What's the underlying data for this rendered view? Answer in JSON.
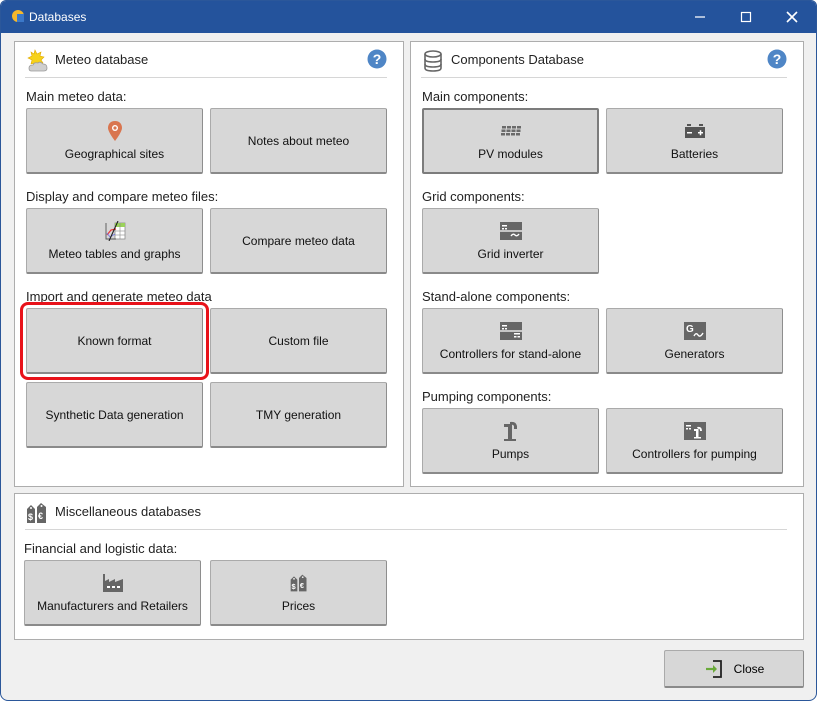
{
  "window": {
    "title": "Databases",
    "controls": {
      "minimize": "minimize",
      "maximize": "maximize",
      "close": "close"
    }
  },
  "meteo": {
    "title": "Meteo database",
    "icon": "sun-cloud-icon",
    "sections": [
      {
        "label": "Main meteo data:"
      },
      {
        "label": "Display and compare meteo files:"
      },
      {
        "label": "Import and generate meteo data"
      }
    ],
    "buttons": {
      "geo_sites": "Geographical sites",
      "notes": "Notes about meteo",
      "tables_graphs": "Meteo tables and graphs",
      "compare": "Compare meteo data",
      "known_format": "Known format",
      "custom_file": "Custom file",
      "synthetic": "Synthetic Data generation",
      "tmy": "TMY generation"
    },
    "highlighted_button": "Known format",
    "highlight_color": "#e8121a"
  },
  "components": {
    "title": "Components Database",
    "icon": "database-icon",
    "sections": [
      {
        "label": "Main components:"
      },
      {
        "label": "Grid components:"
      },
      {
        "label": "Stand-alone components:"
      },
      {
        "label": "Pumping components:"
      }
    ],
    "buttons": {
      "pv_modules": "PV modules",
      "batteries": "Batteries",
      "grid_inverter": "Grid inverter",
      "controllers_standalone": "Controllers for stand-alone",
      "generators": "Generators",
      "pumps": "Pumps",
      "controllers_pumping": "Controllers for pumping"
    }
  },
  "misc": {
    "title": "Miscellaneous databases",
    "icon": "prices-tag-icon",
    "sections": [
      {
        "label": "Financial and logistic data:"
      }
    ],
    "buttons": {
      "manufacturers": "Manufacturers and Retailers",
      "prices": "Prices"
    }
  },
  "footer": {
    "close_label": "Close"
  },
  "colors": {
    "titlebar": "#24539c",
    "button_bg": "#d7d7d7",
    "help_icon": "#4f86c6",
    "geo_pin": "#d9754f",
    "close_arrow": "#6aaa3a"
  }
}
